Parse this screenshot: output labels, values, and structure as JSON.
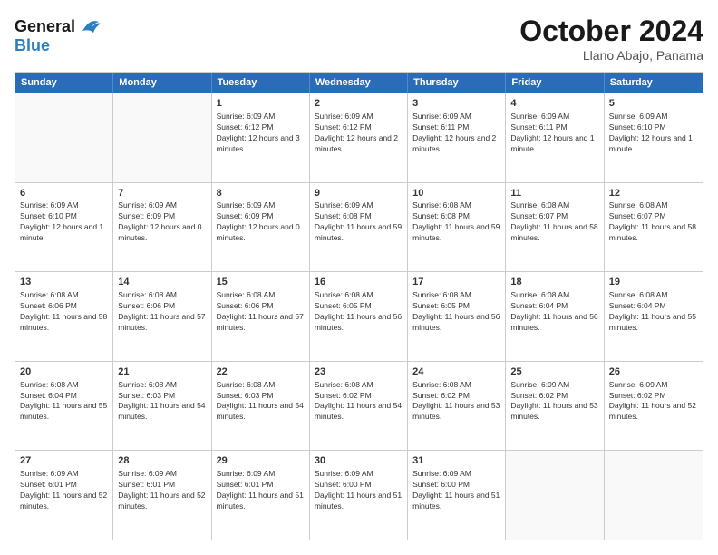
{
  "header": {
    "logo_line1": "General",
    "logo_line2": "Blue",
    "month": "October 2024",
    "location": "Llano Abajo, Panama"
  },
  "weekdays": [
    "Sunday",
    "Monday",
    "Tuesday",
    "Wednesday",
    "Thursday",
    "Friday",
    "Saturday"
  ],
  "rows": [
    [
      {
        "day": "",
        "text": ""
      },
      {
        "day": "",
        "text": ""
      },
      {
        "day": "1",
        "text": "Sunrise: 6:09 AM\nSunset: 6:12 PM\nDaylight: 12 hours and 3 minutes."
      },
      {
        "day": "2",
        "text": "Sunrise: 6:09 AM\nSunset: 6:12 PM\nDaylight: 12 hours and 2 minutes."
      },
      {
        "day": "3",
        "text": "Sunrise: 6:09 AM\nSunset: 6:11 PM\nDaylight: 12 hours and 2 minutes."
      },
      {
        "day": "4",
        "text": "Sunrise: 6:09 AM\nSunset: 6:11 PM\nDaylight: 12 hours and 1 minute."
      },
      {
        "day": "5",
        "text": "Sunrise: 6:09 AM\nSunset: 6:10 PM\nDaylight: 12 hours and 1 minute."
      }
    ],
    [
      {
        "day": "6",
        "text": "Sunrise: 6:09 AM\nSunset: 6:10 PM\nDaylight: 12 hours and 1 minute."
      },
      {
        "day": "7",
        "text": "Sunrise: 6:09 AM\nSunset: 6:09 PM\nDaylight: 12 hours and 0 minutes."
      },
      {
        "day": "8",
        "text": "Sunrise: 6:09 AM\nSunset: 6:09 PM\nDaylight: 12 hours and 0 minutes."
      },
      {
        "day": "9",
        "text": "Sunrise: 6:09 AM\nSunset: 6:08 PM\nDaylight: 11 hours and 59 minutes."
      },
      {
        "day": "10",
        "text": "Sunrise: 6:08 AM\nSunset: 6:08 PM\nDaylight: 11 hours and 59 minutes."
      },
      {
        "day": "11",
        "text": "Sunrise: 6:08 AM\nSunset: 6:07 PM\nDaylight: 11 hours and 58 minutes."
      },
      {
        "day": "12",
        "text": "Sunrise: 6:08 AM\nSunset: 6:07 PM\nDaylight: 11 hours and 58 minutes."
      }
    ],
    [
      {
        "day": "13",
        "text": "Sunrise: 6:08 AM\nSunset: 6:06 PM\nDaylight: 11 hours and 58 minutes."
      },
      {
        "day": "14",
        "text": "Sunrise: 6:08 AM\nSunset: 6:06 PM\nDaylight: 11 hours and 57 minutes."
      },
      {
        "day": "15",
        "text": "Sunrise: 6:08 AM\nSunset: 6:06 PM\nDaylight: 11 hours and 57 minutes."
      },
      {
        "day": "16",
        "text": "Sunrise: 6:08 AM\nSunset: 6:05 PM\nDaylight: 11 hours and 56 minutes."
      },
      {
        "day": "17",
        "text": "Sunrise: 6:08 AM\nSunset: 6:05 PM\nDaylight: 11 hours and 56 minutes."
      },
      {
        "day": "18",
        "text": "Sunrise: 6:08 AM\nSunset: 6:04 PM\nDaylight: 11 hours and 56 minutes."
      },
      {
        "day": "19",
        "text": "Sunrise: 6:08 AM\nSunset: 6:04 PM\nDaylight: 11 hours and 55 minutes."
      }
    ],
    [
      {
        "day": "20",
        "text": "Sunrise: 6:08 AM\nSunset: 6:04 PM\nDaylight: 11 hours and 55 minutes."
      },
      {
        "day": "21",
        "text": "Sunrise: 6:08 AM\nSunset: 6:03 PM\nDaylight: 11 hours and 54 minutes."
      },
      {
        "day": "22",
        "text": "Sunrise: 6:08 AM\nSunset: 6:03 PM\nDaylight: 11 hours and 54 minutes."
      },
      {
        "day": "23",
        "text": "Sunrise: 6:08 AM\nSunset: 6:02 PM\nDaylight: 11 hours and 54 minutes."
      },
      {
        "day": "24",
        "text": "Sunrise: 6:08 AM\nSunset: 6:02 PM\nDaylight: 11 hours and 53 minutes."
      },
      {
        "day": "25",
        "text": "Sunrise: 6:09 AM\nSunset: 6:02 PM\nDaylight: 11 hours and 53 minutes."
      },
      {
        "day": "26",
        "text": "Sunrise: 6:09 AM\nSunset: 6:02 PM\nDaylight: 11 hours and 52 minutes."
      }
    ],
    [
      {
        "day": "27",
        "text": "Sunrise: 6:09 AM\nSunset: 6:01 PM\nDaylight: 11 hours and 52 minutes."
      },
      {
        "day": "28",
        "text": "Sunrise: 6:09 AM\nSunset: 6:01 PM\nDaylight: 11 hours and 52 minutes."
      },
      {
        "day": "29",
        "text": "Sunrise: 6:09 AM\nSunset: 6:01 PM\nDaylight: 11 hours and 51 minutes."
      },
      {
        "day": "30",
        "text": "Sunrise: 6:09 AM\nSunset: 6:00 PM\nDaylight: 11 hours and 51 minutes."
      },
      {
        "day": "31",
        "text": "Sunrise: 6:09 AM\nSunset: 6:00 PM\nDaylight: 11 hours and 51 minutes."
      },
      {
        "day": "",
        "text": ""
      },
      {
        "day": "",
        "text": ""
      }
    ]
  ]
}
